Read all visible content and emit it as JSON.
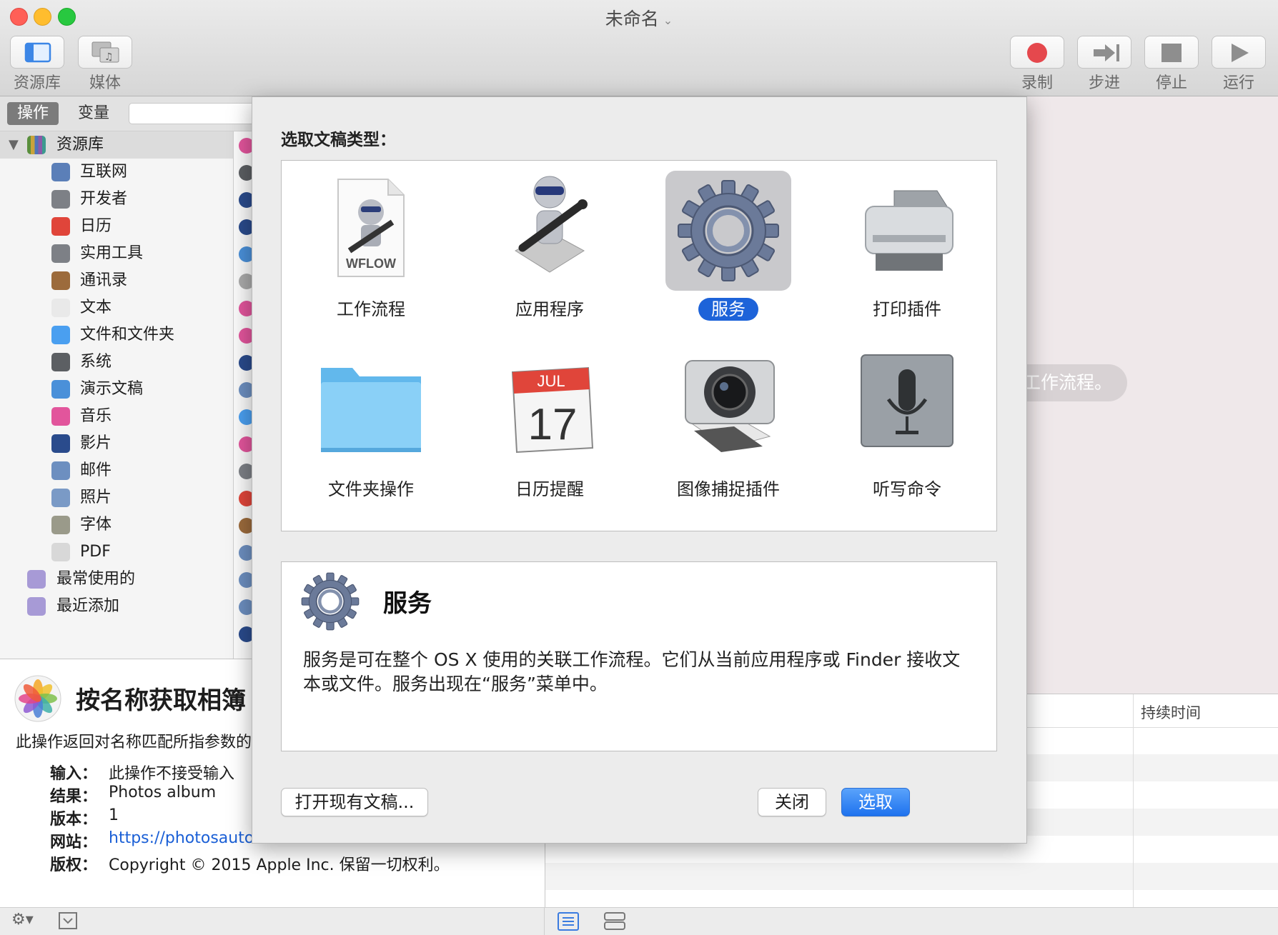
{
  "window": {
    "title": "未命名",
    "title_menu_icon": "chevron-down-icon"
  },
  "toolbar": {
    "library": "资源库",
    "media": "媒体",
    "record": "录制",
    "step": "步进",
    "stop": "停止",
    "run": "运行"
  },
  "left_tabs": {
    "actions": "操作",
    "variables": "变量"
  },
  "library": {
    "root": "资源库",
    "items": [
      {
        "label": "互联网",
        "icon": "globe-icon"
      },
      {
        "label": "开发者",
        "icon": "tools-icon"
      },
      {
        "label": "日历",
        "icon": "calendar-icon"
      },
      {
        "label": "实用工具",
        "icon": "tools-icon"
      },
      {
        "label": "通讯录",
        "icon": "contacts-icon"
      },
      {
        "label": "文本",
        "icon": "text-icon"
      },
      {
        "label": "文件和文件夹",
        "icon": "finder-icon"
      },
      {
        "label": "系统",
        "icon": "system-icon"
      },
      {
        "label": "演示文稿",
        "icon": "keynote-icon"
      },
      {
        "label": "音乐",
        "icon": "music-icon"
      },
      {
        "label": "影片",
        "icon": "quicktime-icon"
      },
      {
        "label": "邮件",
        "icon": "mail-icon"
      },
      {
        "label": "照片",
        "icon": "photos-icon"
      },
      {
        "label": "字体",
        "icon": "font-icon"
      },
      {
        "label": "PDF",
        "icon": "pdf-icon"
      }
    ],
    "smart_groups": [
      {
        "label": "最常使用的",
        "icon": "smart-folder-icon"
      },
      {
        "label": "最近添加",
        "icon": "smart-folder-icon"
      }
    ]
  },
  "action_description": {
    "title": "按名称获取相簿",
    "summary": "此操作返回对名称匹配所指参数的",
    "input_key": "输入：",
    "input_value": "此操作不接受输入",
    "result_key": "结果：",
    "result_value": "Photos album",
    "version_key": "版本：",
    "version_value": "1",
    "website_key": "网站：",
    "website_value": "https://photosautor",
    "copyright_key": "版权：",
    "copyright_value": "Copyright © 2015 Apple Inc. 保留一切权利。"
  },
  "workflow_area": {
    "hint": "工作流程。"
  },
  "log_table": {
    "duration_header": "持续时间"
  },
  "sheet": {
    "heading": "选取文稿类型：",
    "types": [
      {
        "label": "工作流程",
        "icon": "workflow-file-icon",
        "badge": "WFLOW",
        "selected": false
      },
      {
        "label": "应用程序",
        "icon": "automator-robot-icon",
        "selected": false
      },
      {
        "label": "服务",
        "icon": "gear-icon",
        "selected": true
      },
      {
        "label": "打印插件",
        "icon": "printer-icon",
        "selected": false
      },
      {
        "label": "文件夹操作",
        "icon": "folder-icon",
        "selected": false
      },
      {
        "label": "日历提醒",
        "icon": "calendar-icon",
        "month": "JUL",
        "day": "17",
        "selected": false
      },
      {
        "label": "图像捕捉插件",
        "icon": "camera-icon",
        "selected": false
      },
      {
        "label": "听写命令",
        "icon": "microphone-icon",
        "selected": false
      }
    ],
    "description": {
      "title": "服务",
      "text": "服务是可在整个 OS X 使用的关联工作流程。它们从当前应用程序或 Finder 接收文本或文件。服务出现在“服务”菜单中。"
    },
    "open_existing": "打开现有文稿...",
    "close": "关闭",
    "choose": "选取"
  },
  "colors": {
    "accent": "#1d63d9",
    "close_light": "#ff5f57",
    "minimize_light": "#ffbd2e",
    "zoom_light": "#28c840",
    "record_red": "#e5484d"
  }
}
